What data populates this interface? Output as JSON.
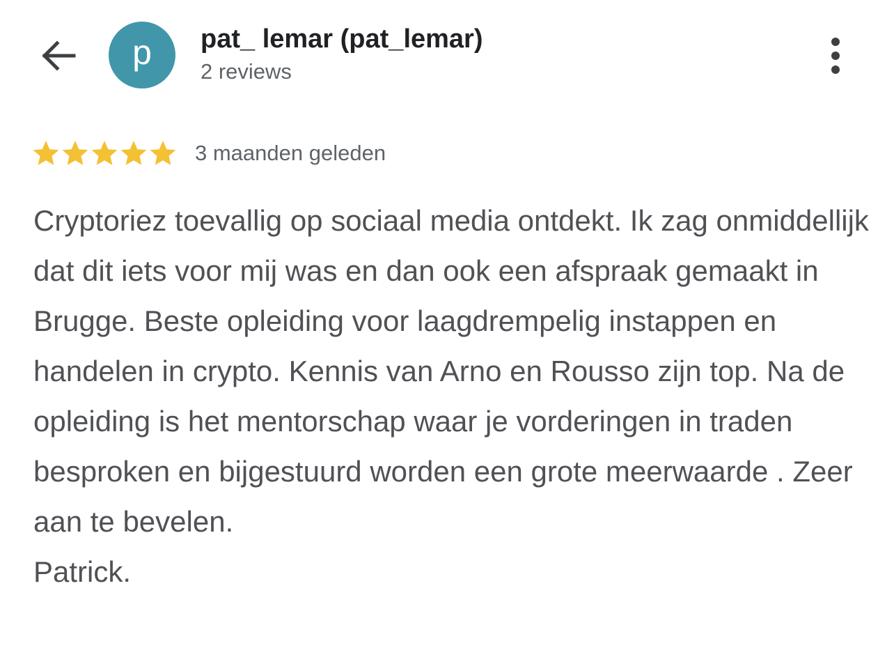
{
  "header": {
    "back_icon": "arrow-left-icon",
    "avatar_letter": "p",
    "avatar_color": "#4197a9",
    "user_name": "pat_ lemar (pat_lemar)",
    "review_count": "2 reviews",
    "more_icon": "more-vertical-icon"
  },
  "review": {
    "rating": 5,
    "rating_max": 5,
    "star_color": "#f4c034",
    "date": "3 maanden geleden",
    "text": "Cryptoriez toevallig op sociaal media ontdekt. Ik zag onmiddellijk dat dit iets voor mij was en dan ook een afspraak gemaakt in Brugge. Beste opleiding voor laagdrempelig instappen en handelen in crypto. Kennis van Arno en Rousso zijn top. Na de opleiding is het mentorschap waar je vorderingen in traden besproken en bijgestuurd worden een grote meerwaarde . Zeer aan te bevelen.\nPatrick."
  }
}
